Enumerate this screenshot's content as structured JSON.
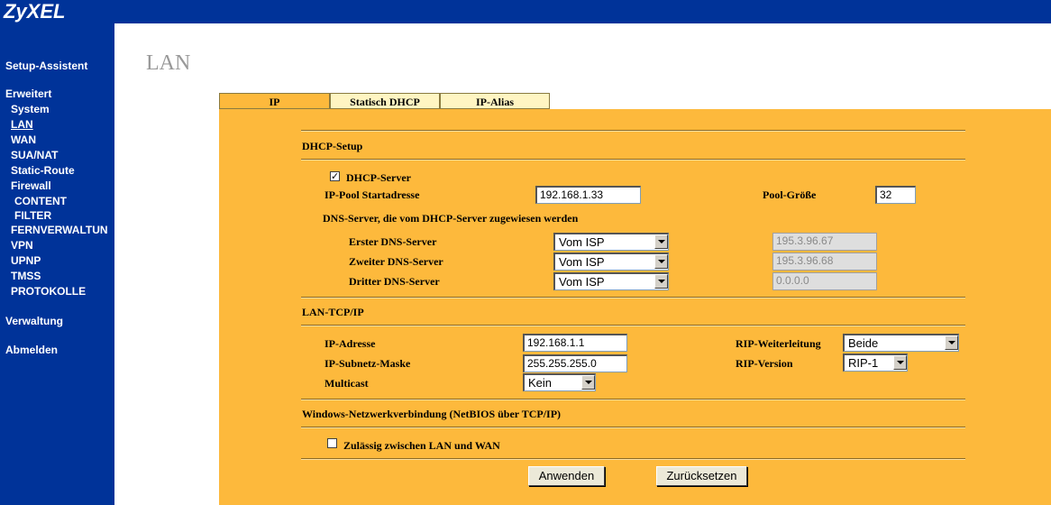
{
  "brand": "ZyXEL",
  "sidebar": {
    "setup_wizard": "Setup-Assistent",
    "advanced": "Erweitert",
    "system": "System",
    "lan": "LAN",
    "wan": "WAN",
    "sua_nat": "SUA/NAT",
    "static_route": "Static-Route",
    "firewall": "Firewall",
    "content": "CONTENT",
    "filter": "FILTER",
    "remote_mgmt": "FERNVERWALTUN",
    "vpn": "VPN",
    "upnp": "UPNP",
    "tmss": "TMSS",
    "logs": "PROTOKOLLE",
    "management": "Verwaltung",
    "logout": "Abmelden"
  },
  "page_title": "LAN",
  "tabs": [
    {
      "label": "IP"
    },
    {
      "label": "Statisch DHCP"
    },
    {
      "label": "IP-Alias"
    }
  ],
  "dhcp": {
    "section_title": "DHCP-Setup",
    "server_label": "DHCP-Server",
    "server_checked": "✓",
    "pool_start_label": "IP-Pool Startadresse",
    "pool_start_value": "192.168.1.33",
    "pool_size_label": "Pool-Größe",
    "pool_size_value": "32",
    "dns_heading": "DNS-Server, die vom DHCP-Server zugewiesen werden",
    "dns": [
      {
        "label": "Erster DNS-Server",
        "mode": "Vom ISP",
        "value": "195.3.96.67"
      },
      {
        "label": "Zweiter DNS-Server",
        "mode": "Vom ISP",
        "value": "195.3.96.68"
      },
      {
        "label": "Dritter DNS-Server",
        "mode": "Vom ISP",
        "value": "0.0.0.0"
      }
    ]
  },
  "lan_tcpip": {
    "section_title": "LAN-TCP/IP",
    "ip_label": "IP-Adresse",
    "ip_value": "192.168.1.1",
    "mask_label": "IP-Subnetz-Maske",
    "mask_value": "255.255.255.0",
    "multicast_label": "Multicast",
    "multicast_value": "Kein",
    "rip_dir_label": "RIP-Weiterleitung",
    "rip_dir_value": "Beide",
    "rip_ver_label": "RIP-Version",
    "rip_ver_value": "RIP-1"
  },
  "netbios": {
    "section_title": "Windows-Netzwerkverbindung (NetBIOS über TCP/IP)",
    "allow_label": "Zulässig zwischen LAN und WAN"
  },
  "buttons": {
    "apply": "Anwenden",
    "reset": "Zurücksetzen"
  },
  "colors": {
    "nav_blue": "#003399",
    "panel_orange": "#FDB93C",
    "tab_active": "#FDB93C",
    "tab_inactive": "#FFF5C2"
  }
}
